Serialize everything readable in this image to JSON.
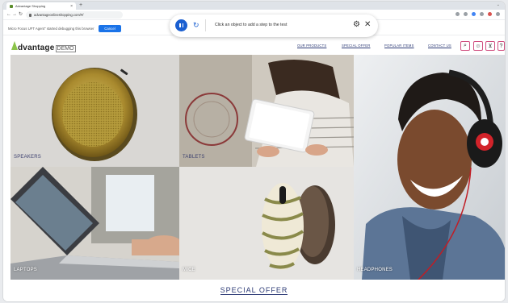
{
  "browser": {
    "tab_title": "Advantage Shopping",
    "new_tab": "+",
    "url": "advantageonlineshopping.com/#/"
  },
  "infobar": {
    "message": "Micro Focus UFT Agent\" started debugging this browser",
    "cancel_label": "Cancel"
  },
  "recorder": {
    "instruction": "Click an object to add a step to the test"
  },
  "site": {
    "logo_word": "dvantage",
    "logo_suffix": "DEMO",
    "nav": [
      "OUR PRODUCTS",
      "SPECIAL OFFER",
      "POPULAR ITEMS",
      "CONTACT US"
    ]
  },
  "categories": [
    {
      "label": "SPEAKERS",
      "color": "#d9d7d4"
    },
    {
      "label": "TABLETS",
      "color": "#c9c4bc"
    },
    {
      "label": "HEADPHONES",
      "color": "#4b5563"
    },
    {
      "label": "LAPTOPS",
      "color": "#7c7f84"
    },
    {
      "label": "MICE",
      "color": "#e4e2df"
    }
  ],
  "special_offer": {
    "title": "SPECIAL OFFER"
  }
}
